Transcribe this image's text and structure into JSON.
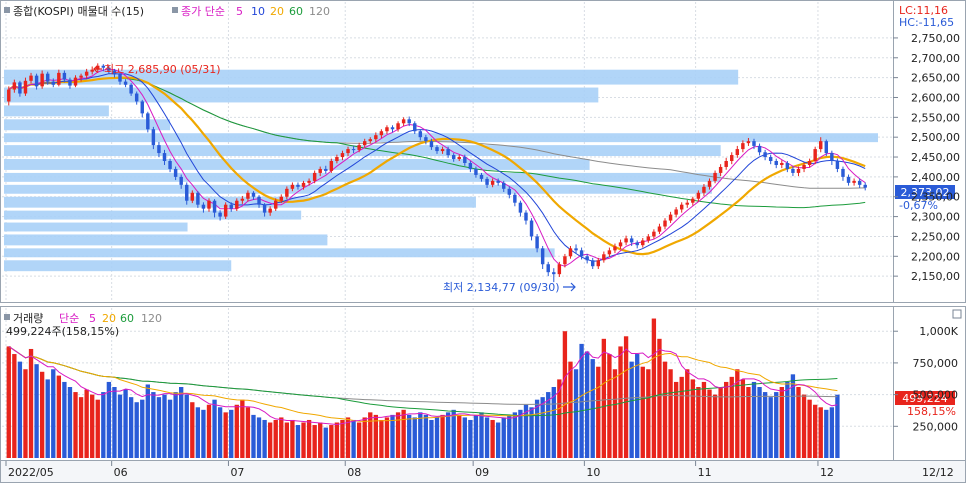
{
  "price_panel": {
    "legend_prefix": "종합(KOSPI) 매물대 수(15)",
    "legend_ma_label": "종가 단순",
    "legend_ma_periods": [
      "5",
      "10",
      "20",
      "60",
      "120"
    ],
    "lc_label": "LC:11,16",
    "hc_label": "HC:-11,65",
    "current_price": "2,373,02",
    "change_pct": "-0,67%",
    "high_annotation": "최고 2,685,90 (05/31)",
    "low_annotation": "최저 2,134,77 (09/30)"
  },
  "volume_panel": {
    "legend_prefix": "거래량",
    "legend_ma_label": "단순",
    "legend_ma_periods": [
      "5",
      "20",
      "60",
      "120"
    ],
    "current_info": "499,224주(158,15%)",
    "current_volume": "499,224",
    "current_ratio": "158,15%"
  },
  "x_axis": {
    "month_labels": [
      {
        "label": "2022/05",
        "index": 0
      },
      {
        "label": "06",
        "index": 19
      },
      {
        "label": "07",
        "index": 40
      },
      {
        "label": "08",
        "index": 61
      },
      {
        "label": "09",
        "index": 84
      },
      {
        "label": "10",
        "index": 104
      },
      {
        "label": "11",
        "index": 124
      },
      {
        "label": "12",
        "index": 146
      }
    ],
    "right_label": "12/12"
  },
  "colors": {
    "up": "#e8241c",
    "down": "#2a5bd7",
    "ma5": "#d81bc4",
    "ma10": "#2246d8",
    "ma20": "#f0a800",
    "ma60": "#1c9c3c",
    "ma120": "#8c8c8c",
    "volume_profile": "#a9d0f7"
  },
  "chart_data": [
    {
      "type": "candlestick",
      "title": "종합(KOSPI)",
      "y_ticks": [
        2150,
        2200,
        2250,
        2300,
        2350,
        2400,
        2450,
        2500,
        2550,
        2600,
        2650,
        2700,
        2750
      ],
      "ylim": [
        2100,
        2775
      ],
      "moving_averages": [
        "5",
        "10",
        "20",
        "60",
        "120"
      ],
      "high": {
        "value": 2685.9,
        "date": "05/31"
      },
      "low": {
        "value": 2134.77,
        "date": "09/30"
      },
      "last_close": 2373.02,
      "change_pct": -0.67,
      "volume_profile": [
        {
          "price_low": 2630,
          "price_high": 2670,
          "relative": 0.84
        },
        {
          "price_low": 2585,
          "price_high": 2625,
          "relative": 0.68
        },
        {
          "price_low": 2550,
          "price_high": 2580,
          "relative": 0.12
        },
        {
          "price_low": 2515,
          "price_high": 2545,
          "relative": 0.19
        },
        {
          "price_low": 2485,
          "price_high": 2510,
          "relative": 1.0
        },
        {
          "price_low": 2450,
          "price_high": 2480,
          "relative": 0.82
        },
        {
          "price_low": 2415,
          "price_high": 2445,
          "relative": 0.67
        },
        {
          "price_low": 2385,
          "price_high": 2410,
          "relative": 0.82
        },
        {
          "price_low": 2355,
          "price_high": 2380,
          "relative": 0.81
        },
        {
          "price_low": 2320,
          "price_high": 2350,
          "relative": 0.54
        },
        {
          "price_low": 2290,
          "price_high": 2315,
          "relative": 0.34
        },
        {
          "price_low": 2260,
          "price_high": 2285,
          "relative": 0.21
        },
        {
          "price_low": 2225,
          "price_high": 2255,
          "relative": 0.37
        },
        {
          "price_low": 2195,
          "price_high": 2220,
          "relative": 0.63
        },
        {
          "price_low": 2160,
          "price_high": 2190,
          "relative": 0.26
        }
      ],
      "candles": [
        [
          2590,
          2620,
          2580,
          2628
        ],
        [
          2620,
          2638,
          2612,
          2645
        ],
        [
          2638,
          2610,
          2602,
          2642
        ],
        [
          2610,
          2642,
          2604,
          2650
        ],
        [
          2642,
          2655,
          2636,
          2662
        ],
        [
          2655,
          2628,
          2620,
          2660
        ],
        [
          2628,
          2660,
          2622,
          2668
        ],
        [
          2660,
          2640,
          2632,
          2665
        ],
        [
          2640,
          2632,
          2626,
          2648
        ],
        [
          2632,
          2662,
          2628,
          2670
        ],
        [
          2662,
          2645,
          2638,
          2668
        ],
        [
          2645,
          2630,
          2622,
          2650
        ],
        [
          2630,
          2650,
          2626,
          2656
        ],
        [
          2650,
          2655,
          2640,
          2660
        ],
        [
          2655,
          2665,
          2648,
          2672
        ],
        [
          2665,
          2670,
          2658,
          2678
        ],
        [
          2670,
          2680,
          2662,
          2686
        ],
        [
          2680,
          2675,
          2666,
          2684
        ],
        [
          2675,
          2668,
          2660,
          2680
        ],
        [
          2668,
          2658,
          2650,
          2672
        ],
        [
          2658,
          2640,
          2632,
          2662
        ],
        [
          2640,
          2632,
          2626,
          2646
        ],
        [
          2632,
          2610,
          2604,
          2636
        ],
        [
          2610,
          2590,
          2582,
          2615
        ],
        [
          2590,
          2560,
          2550,
          2594
        ],
        [
          2560,
          2520,
          2512,
          2564
        ],
        [
          2520,
          2480,
          2470,
          2526
        ],
        [
          2480,
          2460,
          2450,
          2488
        ],
        [
          2460,
          2440,
          2430,
          2468
        ],
        [
          2440,
          2420,
          2412,
          2446
        ],
        [
          2420,
          2400,
          2392,
          2426
        ],
        [
          2400,
          2380,
          2370,
          2406
        ],
        [
          2380,
          2340,
          2330,
          2386
        ],
        [
          2340,
          2360,
          2334,
          2366
        ],
        [
          2360,
          2330,
          2322,
          2364
        ],
        [
          2330,
          2320,
          2310,
          2336
        ],
        [
          2320,
          2340,
          2312,
          2346
        ],
        [
          2340,
          2310,
          2298,
          2344
        ],
        [
          2310,
          2300,
          2290,
          2316
        ],
        [
          2300,
          2330,
          2294,
          2336
        ],
        [
          2330,
          2320,
          2312,
          2336
        ],
        [
          2320,
          2340,
          2314,
          2346
        ],
        [
          2340,
          2345,
          2332,
          2352
        ],
        [
          2345,
          2360,
          2338,
          2366
        ],
        [
          2360,
          2350,
          2342,
          2364
        ],
        [
          2350,
          2330,
          2322,
          2354
        ],
        [
          2330,
          2310,
          2300,
          2334
        ],
        [
          2310,
          2320,
          2302,
          2326
        ],
        [
          2320,
          2340,
          2314,
          2346
        ],
        [
          2340,
          2350,
          2334,
          2356
        ],
        [
          2350,
          2370,
          2344,
          2376
        ],
        [
          2370,
          2380,
          2364,
          2386
        ],
        [
          2380,
          2375,
          2368,
          2386
        ],
        [
          2375,
          2385,
          2368,
          2390
        ],
        [
          2385,
          2390,
          2378,
          2396
        ],
        [
          2390,
          2410,
          2384,
          2416
        ],
        [
          2410,
          2420,
          2402,
          2426
        ],
        [
          2420,
          2415,
          2408,
          2428
        ],
        [
          2415,
          2440,
          2410,
          2446
        ],
        [
          2440,
          2450,
          2434,
          2456
        ],
        [
          2450,
          2460,
          2442,
          2466
        ],
        [
          2460,
          2470,
          2452,
          2476
        ],
        [
          2470,
          2468,
          2460,
          2478
        ],
        [
          2468,
          2480,
          2462,
          2486
        ],
        [
          2480,
          2490,
          2474,
          2496
        ],
        [
          2490,
          2495,
          2484,
          2500
        ],
        [
          2495,
          2505,
          2488,
          2512
        ],
        [
          2505,
          2515,
          2498,
          2520
        ],
        [
          2515,
          2525,
          2508,
          2530
        ],
        [
          2525,
          2520,
          2512,
          2530
        ],
        [
          2520,
          2535,
          2514,
          2540
        ],
        [
          2535,
          2545,
          2528,
          2550
        ],
        [
          2545,
          2535,
          2528,
          2552
        ],
        [
          2535,
          2515,
          2508,
          2540
        ],
        [
          2515,
          2500,
          2492,
          2520
        ],
        [
          2500,
          2490,
          2482,
          2506
        ],
        [
          2490,
          2475,
          2468,
          2496
        ],
        [
          2475,
          2465,
          2458,
          2480
        ],
        [
          2465,
          2470,
          2458,
          2476
        ],
        [
          2470,
          2455,
          2448,
          2476
        ],
        [
          2455,
          2445,
          2438,
          2460
        ],
        [
          2445,
          2450,
          2440,
          2456
        ],
        [
          2450,
          2435,
          2428,
          2456
        ],
        [
          2435,
          2420,
          2412,
          2440
        ],
        [
          2420,
          2405,
          2398,
          2426
        ],
        [
          2405,
          2395,
          2388,
          2410
        ],
        [
          2395,
          2380,
          2372,
          2400
        ],
        [
          2380,
          2390,
          2374,
          2396
        ],
        [
          2390,
          2385,
          2378,
          2396
        ],
        [
          2385,
          2370,
          2362,
          2390
        ],
        [
          2370,
          2355,
          2346,
          2376
        ],
        [
          2355,
          2335,
          2326,
          2360
        ],
        [
          2335,
          2310,
          2300,
          2340
        ],
        [
          2310,
          2290,
          2280,
          2316
        ],
        [
          2290,
          2250,
          2240,
          2296
        ],
        [
          2250,
          2220,
          2210,
          2256
        ],
        [
          2220,
          2180,
          2168,
          2226
        ],
        [
          2180,
          2160,
          2150,
          2186
        ],
        [
          2160,
          2155,
          2135,
          2170
        ],
        [
          2155,
          2180,
          2148,
          2186
        ],
        [
          2180,
          2200,
          2172,
          2206
        ],
        [
          2200,
          2220,
          2194,
          2226
        ],
        [
          2220,
          2215,
          2206,
          2230
        ],
        [
          2215,
          2200,
          2192,
          2222
        ],
        [
          2200,
          2190,
          2182,
          2206
        ],
        [
          2190,
          2175,
          2168,
          2196
        ],
        [
          2175,
          2190,
          2168,
          2196
        ],
        [
          2190,
          2205,
          2184,
          2212
        ],
        [
          2205,
          2215,
          2198,
          2222
        ],
        [
          2215,
          2225,
          2208,
          2232
        ],
        [
          2225,
          2235,
          2218,
          2242
        ],
        [
          2235,
          2245,
          2228,
          2252
        ],
        [
          2245,
          2235,
          2226,
          2252
        ],
        [
          2235,
          2228,
          2220,
          2240
        ],
        [
          2228,
          2240,
          2222,
          2246
        ],
        [
          2240,
          2250,
          2234,
          2256
        ],
        [
          2250,
          2262,
          2244,
          2268
        ],
        [
          2262,
          2275,
          2256,
          2282
        ],
        [
          2275,
          2290,
          2268,
          2296
        ],
        [
          2290,
          2305,
          2284,
          2312
        ],
        [
          2305,
          2318,
          2298,
          2324
        ],
        [
          2318,
          2330,
          2310,
          2336
        ],
        [
          2330,
          2335,
          2322,
          2342
        ],
        [
          2335,
          2345,
          2328,
          2350
        ],
        [
          2345,
          2360,
          2338,
          2366
        ],
        [
          2360,
          2375,
          2352,
          2382
        ],
        [
          2375,
          2390,
          2368,
          2396
        ],
        [
          2390,
          2410,
          2384,
          2416
        ],
        [
          2410,
          2425,
          2402,
          2432
        ],
        [
          2425,
          2440,
          2418,
          2448
        ],
        [
          2440,
          2455,
          2432,
          2462
        ],
        [
          2455,
          2470,
          2448,
          2478
        ],
        [
          2470,
          2485,
          2462,
          2492
        ],
        [
          2485,
          2490,
          2478,
          2498
        ],
        [
          2490,
          2478,
          2470,
          2496
        ],
        [
          2478,
          2462,
          2454,
          2484
        ],
        [
          2462,
          2450,
          2442,
          2468
        ],
        [
          2450,
          2440,
          2432,
          2456
        ],
        [
          2440,
          2430,
          2422,
          2446
        ],
        [
          2430,
          2435,
          2422,
          2442
        ],
        [
          2435,
          2420,
          2412,
          2440
        ],
        [
          2420,
          2410,
          2402,
          2426
        ],
        [
          2410,
          2420,
          2402,
          2426
        ],
        [
          2420,
          2430,
          2412,
          2436
        ],
        [
          2430,
          2440,
          2424,
          2446
        ],
        [
          2440,
          2470,
          2432,
          2476
        ],
        [
          2470,
          2490,
          2462,
          2500
        ],
        [
          2490,
          2460,
          2452,
          2494
        ],
        [
          2460,
          2440,
          2430,
          2466
        ],
        [
          2440,
          2420,
          2412,
          2446
        ],
        [
          2420,
          2400,
          2390,
          2426
        ],
        [
          2400,
          2385,
          2378,
          2406
        ],
        [
          2385,
          2390,
          2378,
          2396
        ],
        [
          2390,
          2380,
          2372,
          2396
        ],
        [
          2380,
          2373,
          2366,
          2386
        ]
      ]
    },
    {
      "type": "bar",
      "title": "거래량",
      "y_ticks": [
        250000,
        500000,
        750000,
        1000000
      ],
      "y_tick_labels": [
        "250,000",
        "500,000",
        "750,000",
        "1,000K"
      ],
      "ylim": [
        0,
        1120000
      ],
      "moving_averages": [
        "5",
        "20",
        "60",
        "120"
      ],
      "last_value": 499224,
      "values": [
        880000,
        820000,
        760000,
        700000,
        860000,
        740000,
        680000,
        620000,
        700000,
        650000,
        600000,
        560000,
        520000,
        480000,
        540000,
        500000,
        460000,
        520000,
        600000,
        560000,
        500000,
        540000,
        480000,
        440000,
        460000,
        580000,
        520000,
        480000,
        500000,
        460000,
        520000,
        560000,
        500000,
        440000,
        400000,
        380000,
        420000,
        460000,
        400000,
        360000,
        380000,
        420000,
        460000,
        400000,
        340000,
        320000,
        300000,
        280000,
        300000,
        320000,
        280000,
        300000,
        260000,
        280000,
        300000,
        260000,
        280000,
        240000,
        260000,
        280000,
        300000,
        320000,
        300000,
        280000,
        320000,
        360000,
        340000,
        300000,
        320000,
        340000,
        360000,
        380000,
        340000,
        320000,
        360000,
        340000,
        300000,
        320000,
        340000,
        360000,
        380000,
        340000,
        320000,
        300000,
        340000,
        360000,
        320000,
        300000,
        280000,
        320000,
        340000,
        360000,
        380000,
        420000,
        400000,
        460000,
        480000,
        520000,
        560000,
        620000,
        1000000,
        760000,
        700000,
        900000,
        840000,
        780000,
        720000,
        940000,
        820000,
        700000,
        880000,
        960000,
        760000,
        820000,
        720000,
        700000,
        1100000,
        940000,
        760000,
        700000,
        600000,
        640000,
        700000,
        620000,
        560000,
        600000,
        540000,
        500000,
        560000,
        600000,
        640000,
        700000,
        620000,
        560000,
        600000,
        560000,
        520000,
        480000,
        520000,
        560000,
        600000,
        660000,
        560000,
        500000,
        460000,
        420000,
        400000,
        380000,
        400000,
        499224
      ]
    }
  ]
}
